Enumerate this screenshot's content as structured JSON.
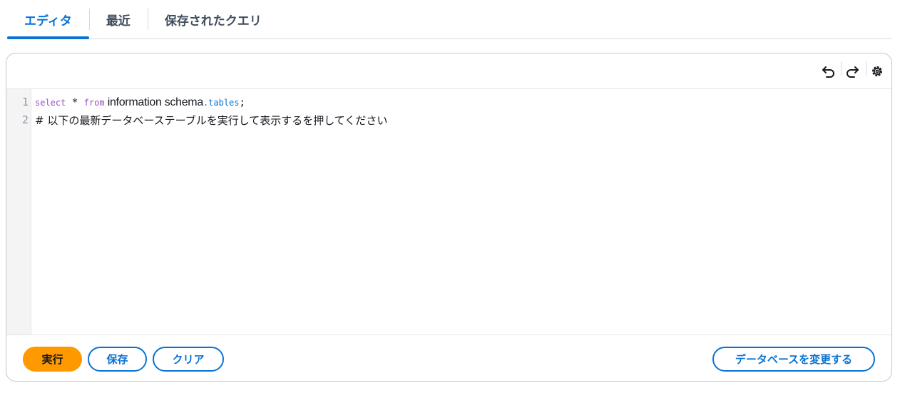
{
  "tabs": [
    {
      "label": "エディタ",
      "active": true
    },
    {
      "label": "最近",
      "active": false
    },
    {
      "label": "保存されたクエリ",
      "active": false
    }
  ],
  "toolbar": {
    "icons": [
      "undo-icon",
      "redo-icon",
      "settings-icon"
    ]
  },
  "editor": {
    "lines": [
      {
        "number": "1",
        "keyword1": "select",
        "star": " * ",
        "keyword2": "from",
        "identifier": " information schema",
        "property": ".tables",
        "end": ";"
      },
      {
        "number": "2",
        "text": "# 以下の最新データベーステーブルを実行して表示するを押してください"
      }
    ]
  },
  "footer": {
    "run_label": "実行",
    "save_label": "保存",
    "clear_label": "クリア",
    "change_db_label": "データベースを変更する"
  },
  "colors": {
    "accent": "#0972d3",
    "primary_button": "#ff9900",
    "keyword": "#9a4ec2"
  }
}
